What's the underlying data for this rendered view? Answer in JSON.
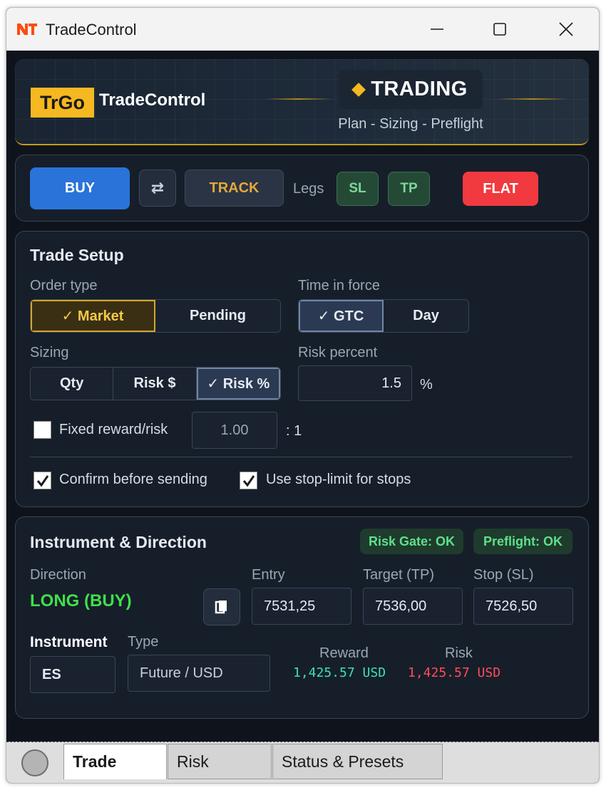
{
  "window": {
    "title": "TradeControl"
  },
  "banner": {
    "brand_badge": "TrGo",
    "brand_name": "TradeControl",
    "mode": "TRADING",
    "subtitle": "Plan - Sizing - Preflight",
    "accent_color": "#f5b820"
  },
  "actions": {
    "buy": "BUY",
    "swap_icon": "⇄",
    "track": "TRACK",
    "legs_label": "Legs",
    "sl": "SL",
    "tp": "TP",
    "flat": "FLAT"
  },
  "trade_setup": {
    "title": "Trade Setup",
    "order_type_label": "Order type",
    "order_type_options": [
      "✓ Market",
      "Pending"
    ],
    "order_type_selected": "Market",
    "tif_label": "Time in force",
    "tif_options": [
      "✓ GTC",
      "Day"
    ],
    "tif_selected": "GTC",
    "sizing_label": "Sizing",
    "sizing_options": [
      "Qty",
      "Risk $",
      "✓ Risk %"
    ],
    "sizing_selected": "Risk %",
    "risk_percent_label": "Risk percent",
    "risk_percent_value": "1.5",
    "risk_percent_unit": "%",
    "fixed_rr_label": "Fixed reward/risk",
    "fixed_rr_checked": false,
    "fixed_rr_value": "1.00",
    "fixed_rr_suffix": ": 1",
    "confirm_label": "Confirm before sending",
    "confirm_checked": true,
    "stop_limit_label": "Use stop-limit for stops",
    "stop_limit_checked": true
  },
  "instrument": {
    "title": "Instrument & Direction",
    "risk_gate": "Risk Gate: OK",
    "preflight": "Preflight: OK",
    "direction_label": "Direction",
    "direction_value": "LONG (BUY)",
    "entry_label": "Entry",
    "entry_value": "7531,25",
    "target_label": "Target (TP)",
    "target_value": "7536,00",
    "stop_label": "Stop (SL)",
    "stop_value": "7526,50",
    "instrument_label": "Instrument",
    "instrument_value": "ES",
    "type_label": "Type",
    "type_value": "Future / USD",
    "reward_label": "Reward",
    "reward_value": "1,425.57 USD",
    "risk_label": "Risk",
    "risk_value": "1,425.57 USD",
    "reward_color": "#3fe0b0",
    "risk_color": "#ff4d57"
  },
  "footer": {
    "tabs": [
      "Trade",
      "Risk",
      "Status & Presets"
    ],
    "active_tab": "Trade"
  }
}
